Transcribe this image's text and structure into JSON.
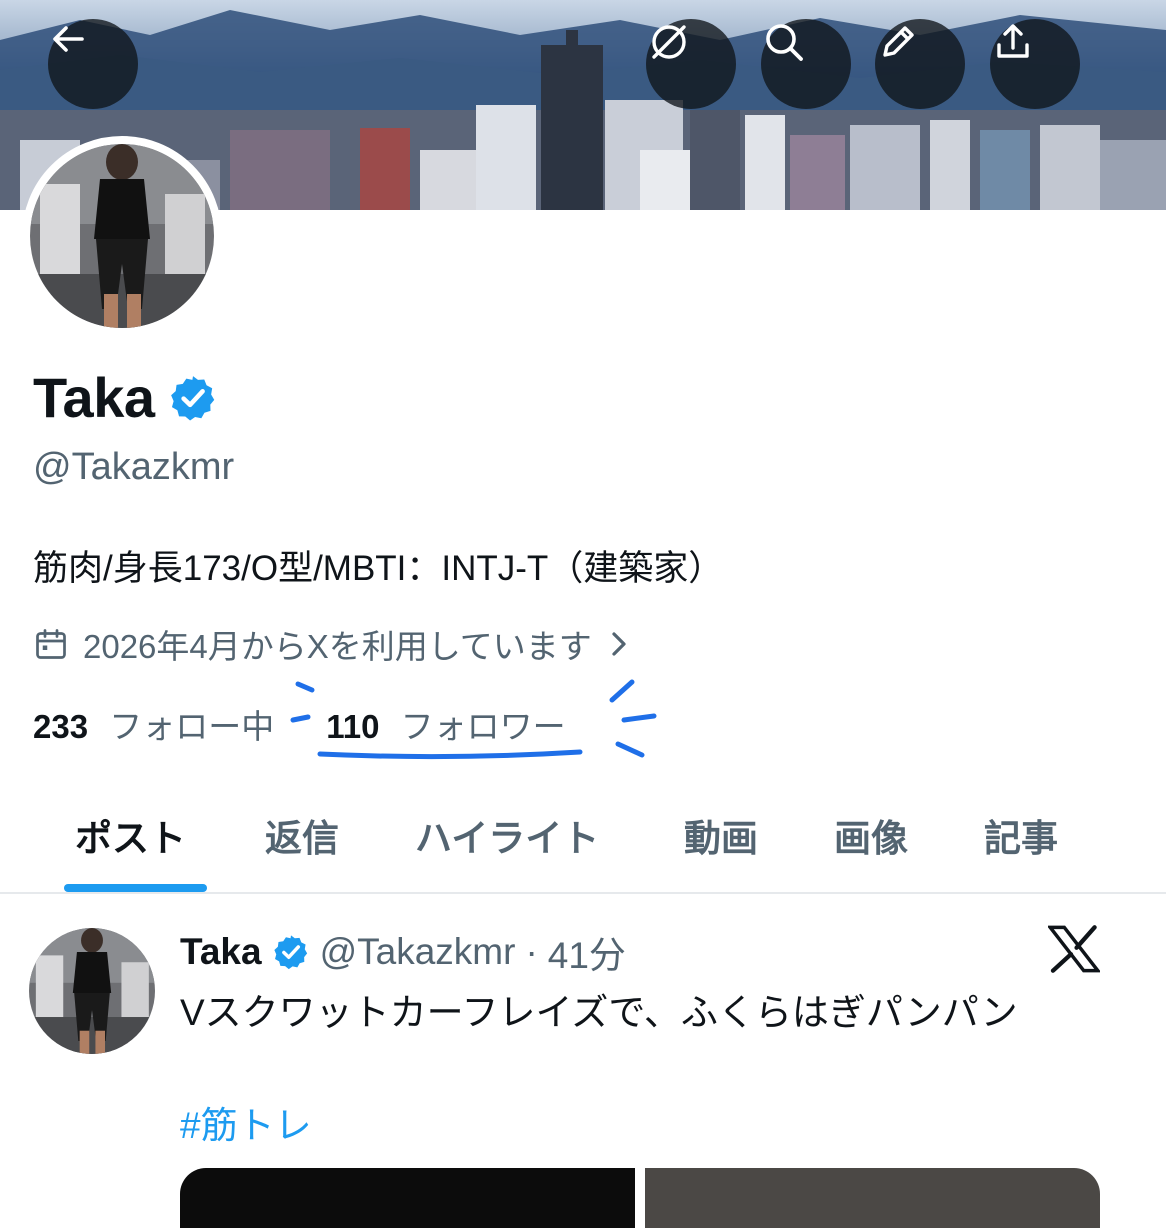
{
  "header": {
    "icons": [
      "back-arrow-icon",
      "grok-icon",
      "search-icon",
      "pencil-icon",
      "share-icon"
    ]
  },
  "profile": {
    "display_name": "Taka",
    "verified": true,
    "handle": "@Takazkmr",
    "bio": "筋肉/身長173/O型/MBTI：INTJ-T（建築家）",
    "joined": "2026年4月からXを利用しています",
    "following_count": "233",
    "following_label": "フォロー中",
    "followers_count": "110",
    "followers_label": "フォロワー"
  },
  "tabs": [
    {
      "label": "ポスト",
      "active": true
    },
    {
      "label": "返信",
      "active": false
    },
    {
      "label": "ハイライト",
      "active": false
    },
    {
      "label": "動画",
      "active": false
    },
    {
      "label": "画像",
      "active": false
    },
    {
      "label": "記事",
      "active": false
    }
  ],
  "post": {
    "name": "Taka",
    "handle": "@Takazkmr",
    "separator": "·",
    "time": "41分",
    "text": "Vスクワットカーフレイズで、ふくらはぎパンパン",
    "hashtag": "#筋トレ"
  },
  "colors": {
    "accent": "#1d9bf0",
    "text": "#0f1419",
    "secondary": "#536471"
  }
}
